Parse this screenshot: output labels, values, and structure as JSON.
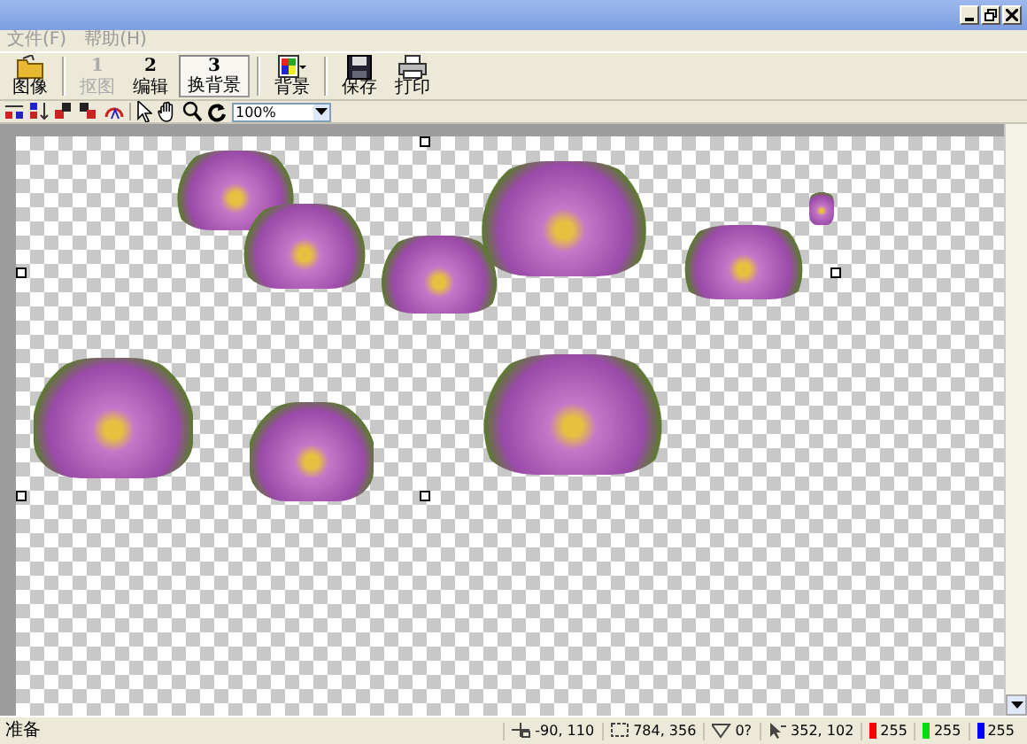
{
  "menu": [
    {
      "label": "文件(F)"
    },
    {
      "label": "帮助(H)"
    }
  ],
  "toolbar": {
    "buttons": [
      {
        "label": "图像",
        "disabled": false,
        "selected": false
      },
      {
        "number": "1",
        "label": "抠图",
        "disabled": true,
        "selected": false
      },
      {
        "number": "2",
        "label": "编辑",
        "disabled": false,
        "selected": false
      },
      {
        "number": "3",
        "label": "换背景",
        "disabled": false,
        "selected": true
      },
      {
        "label": "背景",
        "disabled": false,
        "selected": false
      },
      {
        "label": "保存",
        "disabled": false,
        "selected": false
      },
      {
        "label": "打印",
        "disabled": false,
        "selected": false
      }
    ]
  },
  "tools": {
    "zoom": "100%"
  },
  "status_bar": {
    "message": "准备",
    "fields": [
      "-90, 110",
      "784, 356",
      "0?",
      "352, 102"
    ],
    "channels": [
      {
        "value": "255",
        "color": "#ff0000"
      },
      {
        "value": "255",
        "color": "#00dd00"
      },
      {
        "value": "255",
        "color": "#0000ff"
      }
    ]
  }
}
